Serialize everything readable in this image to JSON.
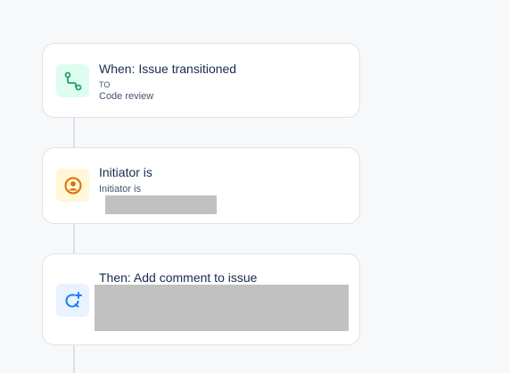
{
  "flow": {
    "trigger": {
      "title": "When: Issue transitioned",
      "label_to": "TO",
      "status": "Code review",
      "icon": "branch-icon",
      "icon_bg": "#dffcf0",
      "icon_color": "#22a06b"
    },
    "condition": {
      "title": "Initiator is",
      "subtitle": "Initiator is",
      "icon": "user-icon",
      "icon_bg": "#fff7d6",
      "icon_color": "#e06c00"
    },
    "action": {
      "title": "Then: Add comment to issue",
      "icon": "comment-add-icon",
      "icon_bg": "#e9f2ff",
      "icon_color": "#1d7afc"
    }
  }
}
